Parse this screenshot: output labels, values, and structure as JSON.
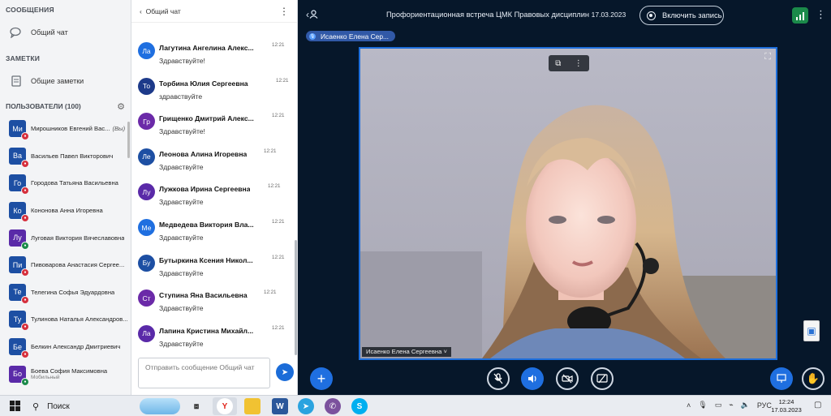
{
  "left": {
    "messages_title": "СООБЩЕНИЯ",
    "public_chat": "Общий чат",
    "notes_title": "ЗАМЕТКИ",
    "shared_notes": "Общие заметки",
    "users_title": "ПОЛЬЗОВАТЕЛИ (100)",
    "users": [
      {
        "initials": "Ми",
        "name": "Мирошников Евгений Вас...",
        "you": "(Вы)",
        "color": "#1d4fa3",
        "mic": "off",
        "sub": ""
      },
      {
        "initials": "Ва",
        "name": "Васильев Павел Викторович",
        "you": "",
        "color": "#1d4fa3",
        "mic": "off",
        "sub": ""
      },
      {
        "initials": "Го",
        "name": "Городова Татьяна Васильевна",
        "you": "",
        "color": "#1d4fa3",
        "mic": "off",
        "sub": ""
      },
      {
        "initials": "Ко",
        "name": "Кононова Анна Игоревна",
        "you": "",
        "color": "#1d4fa3",
        "mic": "off",
        "sub": ""
      },
      {
        "initials": "Лу",
        "name": "Луговая Виктория Вячеславовна",
        "you": "",
        "color": "#5a2aa8",
        "mic": "on",
        "sub": ""
      },
      {
        "initials": "Пи",
        "name": "Пивоварова Анастасия Сергее...",
        "you": "",
        "color": "#1d4fa3",
        "mic": "off",
        "sub": ""
      },
      {
        "initials": "Те",
        "name": "Телегина Софья Эдуардовна",
        "you": "",
        "color": "#1d4fa3",
        "mic": "off",
        "sub": ""
      },
      {
        "initials": "Ту",
        "name": "Тулинова Наталья Александров...",
        "you": "",
        "color": "#1d4fa3",
        "mic": "off",
        "sub": ""
      },
      {
        "initials": "Бе",
        "name": "Белкин Александр Дмитриевич",
        "you": "",
        "color": "#1d4fa3",
        "mic": "off",
        "sub": ""
      },
      {
        "initials": "Бо",
        "name": "Боева София Максимовна",
        "you": "",
        "color": "#5a2aa8",
        "mic": "on",
        "sub": "Мобильный"
      }
    ]
  },
  "chat": {
    "back_label": "Общий чат",
    "compose_placeholder": "Отправить сообщение Общий чат",
    "messages": [
      {
        "initials": "Ла",
        "name": "Лагутина Ангелина Алекс...",
        "time": "12:21",
        "text": "Здравствуйте!",
        "color": "#1f6fe0"
      },
      {
        "initials": "То",
        "name": "Торбина Юлия Сергеевна",
        "time": "12:21",
        "text": "здравствуйте",
        "color": "#1d3a8a"
      },
      {
        "initials": "Гр",
        "name": "Грищенко Дмитрий Алекс...",
        "time": "12:21",
        "text": "Здравствуйте!",
        "color": "#6b2aa8"
      },
      {
        "initials": "Ле",
        "name": "Леонова Алина Игоревна",
        "time": "12:21",
        "text": "Здравствуйте",
        "color": "#1d4fa3"
      },
      {
        "initials": "Лу",
        "name": "Лужкова Ирина Сергеевна",
        "time": "12:21",
        "text": "Здравствуйте",
        "color": "#5a2aa8"
      },
      {
        "initials": "Ме",
        "name": "Медведева Виктория Вла...",
        "time": "12:21",
        "text": "Здравствуйте",
        "color": "#1f6fe0"
      },
      {
        "initials": "Бу",
        "name": "Бутыркина Ксения Никол...",
        "time": "12:21",
        "text": "Здравствуйте",
        "color": "#1d4fa3"
      },
      {
        "initials": "Ст",
        "name": "Ступина Яна Васильевна",
        "time": "12:21",
        "text": "Здравствуйте",
        "color": "#6b2aa8"
      },
      {
        "initials": "Ла",
        "name": "Лапина Кристина Михайл...",
        "time": "12:21",
        "text": "Здравствуйте",
        "color": "#5a2aa8"
      }
    ]
  },
  "main": {
    "title": "Профориентационная встреча ЦМК Правовых дисциплин",
    "date": "17.03.2023",
    "record_label": "Включить запись",
    "talking": "Исаенко Елена Сер...",
    "video_name": "Исаенко Елена Сергеевна"
  },
  "taskbar": {
    "search": "Поиск",
    "lang": "РУС",
    "time": "12:24",
    "date": "17.03.2023"
  },
  "colors": {
    "accent": "#1f6fe0",
    "background": "#06172a",
    "mic_off": "#d6303d",
    "mic_on": "#1b8a4a"
  }
}
